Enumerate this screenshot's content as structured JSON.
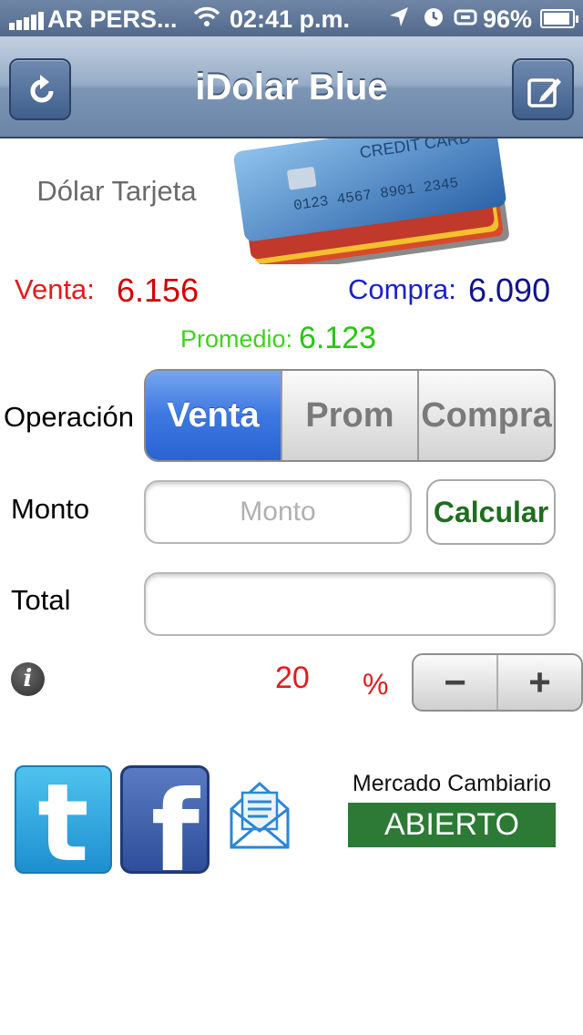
{
  "status_bar": {
    "carrier": "AR PERS...",
    "time": "02:41 p.m.",
    "battery": "96%",
    "icons": [
      "signal-icon",
      "wifi-icon",
      "location-icon",
      "alarm-icon",
      "sync-icon",
      "battery-icon"
    ]
  },
  "nav": {
    "title": "iDolar Blue",
    "left_icon": "refresh-icon",
    "right_icon": "edit-icon"
  },
  "header": {
    "dolar_type": "Dólar Tarjeta",
    "image": "credit-cards-image"
  },
  "rates": {
    "venta_label": "Venta:",
    "venta_value": "6.156",
    "compra_label": "Compra:",
    "compra_value": "6.090",
    "promedio_label": "Promedio:",
    "promedio_value": "6.123"
  },
  "form": {
    "operacion_label": "Operación",
    "segments": [
      "Venta",
      "Prom",
      "Compra"
    ],
    "selected_segment": "Venta",
    "monto_label": "Monto",
    "monto_placeholder": "Monto",
    "calcular_label": "Calcular",
    "total_label": "Total",
    "total_value": "",
    "percent_value": "20",
    "percent_sign": "%",
    "stepper": {
      "minus": "−",
      "plus": "+"
    }
  },
  "footer": {
    "social_icons": [
      "twitter-icon",
      "facebook-icon",
      "mail-icon"
    ],
    "mercado_label": "Mercado Cambiario",
    "market_status": "ABIERTO"
  },
  "colors": {
    "venta": "#e31b1b",
    "compra": "#1a22c8",
    "promedio": "#3bd41b",
    "selected_segment": "#3d78e0",
    "calcular": "#1f6d1f",
    "market_status_bg": "#2c7a35"
  }
}
